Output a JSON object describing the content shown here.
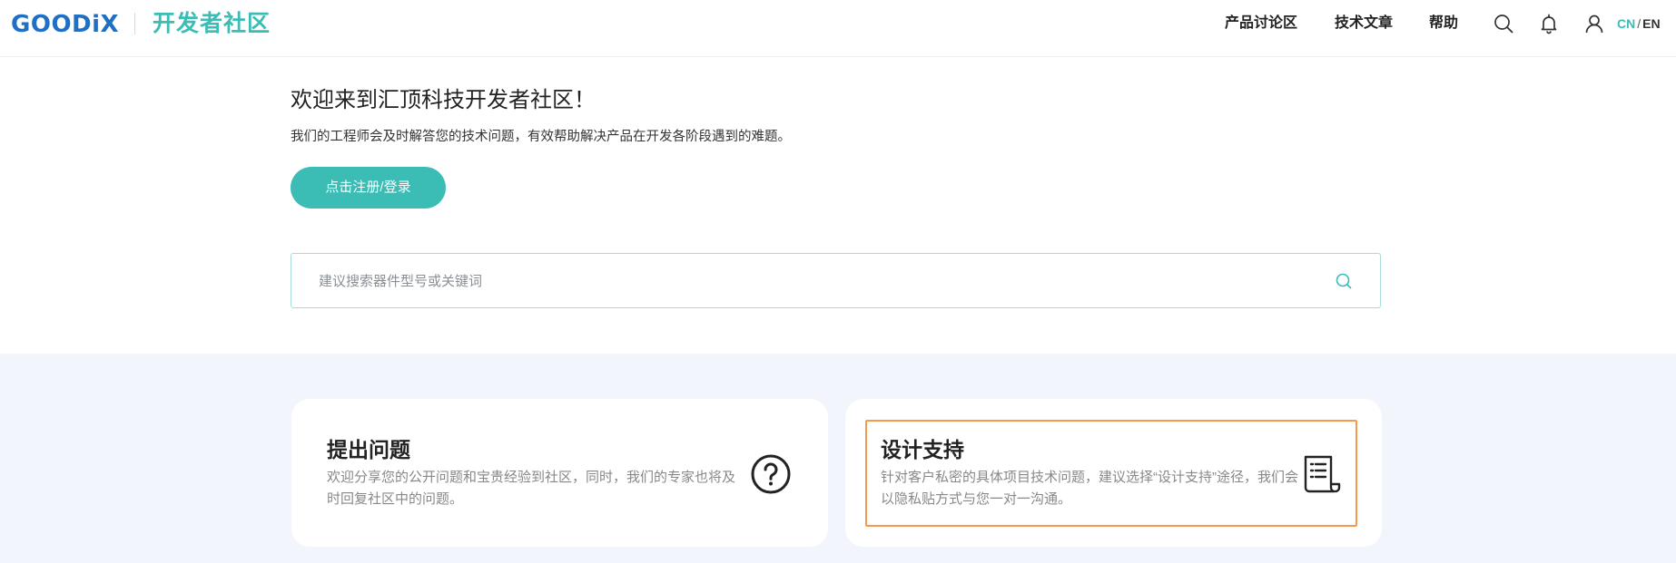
{
  "header": {
    "logo_text": "GOODiX",
    "community_title": "开发者社区",
    "nav": [
      {
        "label": "产品讨论区"
      },
      {
        "label": "技术文章"
      },
      {
        "label": "帮助"
      }
    ],
    "icons": [
      "search-icon",
      "bell-icon",
      "user-icon"
    ],
    "lang": {
      "cn": "CN",
      "separator": "/",
      "en": "EN"
    }
  },
  "hero": {
    "title": "欢迎来到汇顶科技开发者社区！",
    "subtitle": "我们的工程师会及时解答您的技术问题，有效帮助解决产品在开发各阶段遇到的难题。",
    "login_button": "点击注册/登录"
  },
  "search": {
    "placeholder": "建议搜索器件型号或关键词",
    "value": ""
  },
  "cards": [
    {
      "title": "提出问题",
      "desc": "欢迎分享您的公开问题和宝贵经验到社区，同时，我们的专家也将及时回复社区中的问题。",
      "icon": "question-circle-icon"
    },
    {
      "title": "设计支持",
      "desc": "针对客户私密的具体项目技术问题，建议选择“设计支持”途径，我们会以隐私贴方式与您一对一沟通。",
      "icon": "document-list-icon"
    }
  ],
  "colors": {
    "brand_blue": "#1f6fc4",
    "accent_teal": "#3bbcb5",
    "band_bg": "#f2f6fc",
    "focus_orange": "#f49a4a"
  }
}
